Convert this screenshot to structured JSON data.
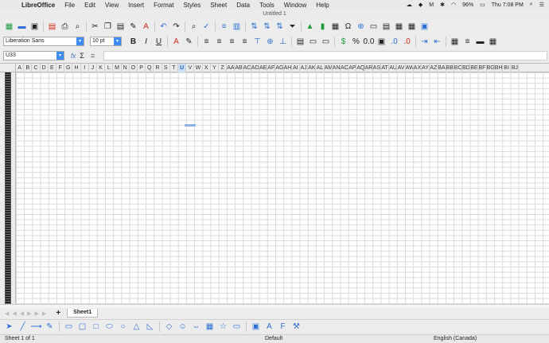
{
  "menubar": {
    "app": "LibreOffice",
    "items": [
      "File",
      "Edit",
      "View",
      "Insert",
      "Format",
      "Styles",
      "Sheet",
      "Data",
      "Tools",
      "Window",
      "Help"
    ],
    "battery": "96%",
    "clock": "Thu 7:08 PM"
  },
  "window": {
    "title": "Untitled 1"
  },
  "format": {
    "font_name": "Liberation Sans",
    "font_size": "10 pt"
  },
  "formula": {
    "cell_ref": "U33",
    "fx": "fx",
    "sigma": "Σ",
    "equals": "="
  },
  "columns": [
    "A",
    "B",
    "C",
    "D",
    "E",
    "F",
    "G",
    "H",
    "I",
    "J",
    "K",
    "L",
    "M",
    "N",
    "O",
    "P",
    "Q",
    "R",
    "S",
    "T",
    "U",
    "V",
    "W",
    "X",
    "Y",
    "Z",
    "AA",
    "AB",
    "AC",
    "AD",
    "AE",
    "AF",
    "AG",
    "AH",
    "AI",
    "AJ",
    "AK",
    "AL",
    "AM",
    "AN",
    "AO",
    "AP",
    "AQ",
    "AR",
    "AS",
    "AT",
    "AU",
    "AV",
    "AW",
    "AX",
    "AY",
    "AZ",
    "BA",
    "BB",
    "BC",
    "BD",
    "BE",
    "BF",
    "BG",
    "BH",
    "BI",
    "BJ"
  ],
  "selected_column": "U",
  "sheets": {
    "active": "Sheet1",
    "add_label": "+"
  },
  "status": {
    "sheet_pos": "Sheet 1 of 1",
    "style": "Default",
    "language": "English (Canada)"
  },
  "colors": {
    "accent": "#3c8ef3",
    "selected_header": "#cfe0f5"
  }
}
